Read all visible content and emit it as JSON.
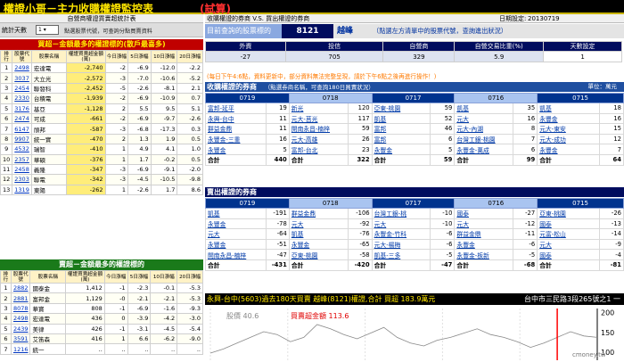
{
  "app": {
    "title": "權證小哥－主力收購權證監控表",
    "tag": "(試算)"
  },
  "left": {
    "header": "自營商權證買賣超統計表",
    "stat_label": "統計天數",
    "stat_value": "1",
    "stat_hint": "點選股票代號，可查詢分點買賣資料",
    "buy_title": "買超－金額最多的權證標的(散戶最喜多)",
    "sell_title": "賣超－金額最多的權證標的",
    "columns": [
      "排行",
      "股票代號",
      "股票名稱",
      "權證買賣超金額(萬)",
      "今日漲幅",
      "5日漲幅",
      "10日漲幅",
      "20日漲幅"
    ],
    "buy_rows": [
      [
        "1",
        "2498",
        "宏達電",
        "-2,740",
        "-2",
        "-6.9",
        "-12.0",
        "-2.2"
      ],
      [
        "2",
        "3037",
        "大立光",
        "-2,572",
        "-3",
        "-7.0",
        "-10.6",
        "-5.2"
      ],
      [
        "3",
        "2454",
        "聯發科",
        "-2,452",
        "-5",
        "-2.6",
        "-8.1",
        "2.1"
      ],
      [
        "4",
        "2330",
        "台積電",
        "-1,939",
        "-2",
        "-6.9",
        "-10.9",
        "0.7"
      ],
      [
        "5",
        "3176",
        "基亞",
        "-1,128",
        "2",
        "5.5",
        "9.5",
        "5.1"
      ],
      [
        "6",
        "2474",
        "可成",
        "-661",
        "-2",
        "-6.9",
        "-9.7",
        "-2.6"
      ],
      [
        "7",
        "6147",
        "頎邦",
        "-587",
        "-3",
        "-6.8",
        "-17.3",
        "0.3"
      ],
      [
        "8",
        "9907",
        "統一實",
        "-470",
        "2",
        "1.3",
        "1.9",
        "0.5"
      ],
      [
        "9",
        "4532",
        "瑞智",
        "-410",
        "1",
        "4.9",
        "4.1",
        "1.0"
      ],
      [
        "10",
        "2357",
        "華碩",
        "-376",
        "1",
        "1.7",
        "-0.2",
        "0.5"
      ],
      [
        "11",
        "2458",
        "義隆",
        "-347",
        "-3",
        "-6.9",
        "-9.1",
        "-2.0"
      ],
      [
        "12",
        "2303",
        "聯電",
        "-342",
        "-3",
        "-4.5",
        "-10.5",
        "-9.8"
      ],
      [
        "13",
        "1319",
        "東陽",
        "-262",
        "1",
        "-2.6",
        "1.7",
        "8.6"
      ]
    ],
    "sell_rows": [
      [
        "1",
        "2882",
        "國泰金",
        "1,412",
        "-1",
        "-2.3",
        "-0.1",
        "-5.3"
      ],
      [
        "2",
        "2881",
        "富邦金",
        "1,129",
        "-0",
        "-2.1",
        "-2.1",
        "-5.3"
      ],
      [
        "3",
        "8078",
        "華寶",
        "808",
        "-1",
        "-6.9",
        "-1.6",
        "-9.3"
      ],
      [
        "4",
        "2498",
        "宏達電",
        "436",
        "0",
        "-3.9",
        "-4.2",
        "-3.0"
      ],
      [
        "5",
        "2439",
        "美律",
        "426",
        "-1",
        "-3.1",
        "-4.5",
        "-5.4"
      ],
      [
        "6",
        "3591",
        "艾笛森",
        "416",
        "1",
        "6.6",
        "-6.2",
        "-9.0"
      ],
      [
        "7",
        "1216",
        "統一",
        "..",
        "..",
        "..",
        "..",
        ".."
      ]
    ]
  },
  "right": {
    "header_left": "收購權證的券商 V.S. 買出權證的券商",
    "header_date_label": "日期設定:",
    "header_date": "20130719",
    "query_label": "目前查詢的股票標的",
    "query_code": "8121",
    "query_name": "越峰",
    "query_hint": "（點選左方清單中的股票代號，查詢進出狀況）",
    "stats_headers": [
      "外資",
      "投信",
      "自營商",
      "自營交易比重(%)",
      "天數設定"
    ],
    "stats_values": [
      "-27",
      "705",
      "329",
      "5.9",
      "1"
    ],
    "warning": "(每日下午4:6點，資料更新中，部分資料無法完整呈現，請於下午6點之後再進行操作！)",
    "buy_section": "收購權證的券商",
    "buy_note": "（點選券商名稱，可查詢180日買賣狀況）",
    "unit": "單位：萬元",
    "buy_dates": [
      "0719",
      "0718",
      "0717",
      "0716",
      "0715"
    ],
    "buy_rows": [
      [
        "富邦-延平",
        "19",
        "新光",
        "120",
        "亞東-桃園",
        "59",
        "凱基",
        "35",
        "凱基",
        "18"
      ],
      [
        "永興-台中",
        "11",
        "元大-莒光",
        "117",
        "凱基",
        "52",
        "元大",
        "16",
        "永豐金",
        "16"
      ],
      [
        "群益金鼎",
        "11",
        "開南永昌-楠梓",
        "59",
        "富邦",
        "46",
        "元大-內湖",
        "8",
        "元大-東安",
        "15"
      ],
      [
        "永豐金-三重",
        "16",
        "元大-高雄",
        "26",
        "富邦",
        "6",
        "台灣工銀-桃園",
        "7",
        "元大-成功",
        "12"
      ],
      [
        "永豐金",
        "5",
        "富邦-台北",
        "23",
        "永豐金",
        "5",
        "永豐金-萬成",
        "6",
        "永豐金",
        "7"
      ]
    ],
    "buy_totals": [
      "合計",
      "440",
      "合計",
      "322",
      "合計",
      "59",
      "合計",
      "99",
      "合計",
      "64"
    ],
    "sell_section": "賣出權證的券商",
    "sell_rows": [
      [
        "凱基",
        "-191",
        "群益金鼎",
        "-106",
        "台灣工銀-桃",
        "-10",
        "國泰",
        "-27",
        "亞東-桃園",
        "-26"
      ],
      [
        "永豐金",
        "-78",
        "元大",
        "-92",
        "元大",
        "-10",
        "元大",
        "-12",
        "國泰",
        "-13"
      ],
      [
        "元大",
        "-64",
        "凱基",
        "-76",
        "永豐金-竹科",
        "-6",
        "群益金鼎",
        "-11",
        "元富-松山",
        "-14"
      ],
      [
        "永豐金",
        "-51",
        "永豐金",
        "-65",
        "元大-楊梅",
        "-6",
        "永豐金",
        "-6",
        "元大",
        "-9"
      ],
      [
        "開南永昌-楠梓",
        "-47",
        "亞東-桃園",
        "-58",
        "凱基-三多",
        "-5",
        "永豐金-板新",
        "-5",
        "國泰",
        "-4"
      ]
    ],
    "sell_totals": [
      "合計",
      "-431",
      "合計",
      "-420",
      "合計",
      "-47",
      "合計",
      "-68",
      "合計",
      "-81"
    ],
    "branch_title": "永興-台中(5603)過去180天買賣 越峰(8121)權證,合計 買超 183.9萬元",
    "branch_address": "台中市三民路3段265號之1 一",
    "chart_legend_price": "股價 40.6",
    "chart_legend_net": "買賣超金額 113.6",
    "watermark": "cmoney.tw",
    "right_ticks": [
      "200",
      "150",
      "100"
    ]
  },
  "chart_data": {
    "type": "line",
    "title": "",
    "series": [
      {
        "name": "股價",
        "values": [
          39.5,
          39.8,
          40.2,
          40.6,
          41.0,
          40.8,
          40.3,
          40.6,
          41.5,
          41.2,
          40.8,
          40.5,
          40.9,
          41.3,
          40.6,
          40.2,
          40.0,
          40.4,
          40.6,
          40.9,
          41.2,
          40.8,
          40.6,
          40.3,
          39.9,
          40.2,
          40.6,
          41.0,
          40.7,
          40.6
        ],
        "color": "#888888"
      }
    ],
    "yticks_right": [
      100,
      150,
      200
    ],
    "ylim": [
      80,
      210
    ],
    "markers": [
      {
        "x": 26,
        "color": "#ff0000",
        "label": "買賣超金額 113.6"
      }
    ]
  }
}
